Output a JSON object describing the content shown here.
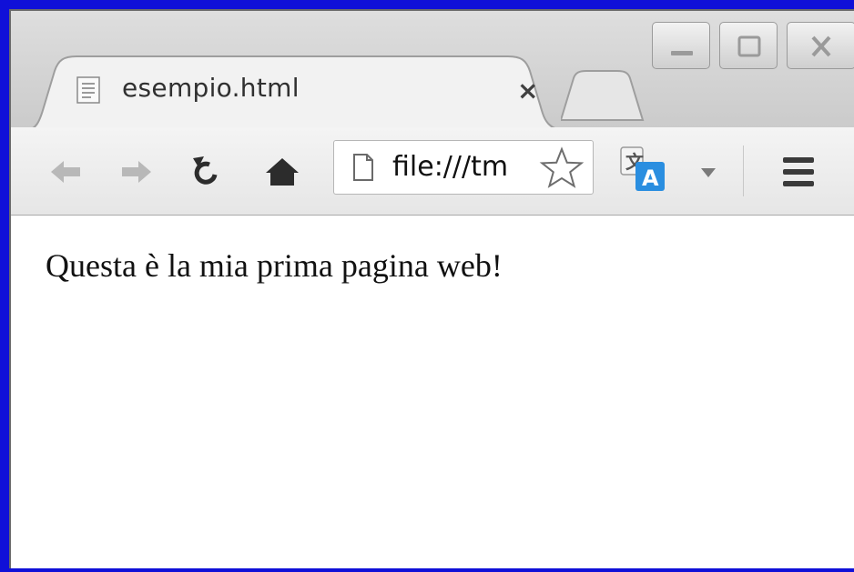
{
  "window": {
    "controls": {
      "minimize_icon": "minimize-icon",
      "maximize_icon": "maximize-icon",
      "close_icon": "close-icon"
    }
  },
  "tab": {
    "title": "esempio.html",
    "close_label": "×",
    "favicon": "document-icon"
  },
  "toolbar": {
    "back_icon": "back-arrow-icon",
    "forward_icon": "forward-arrow-icon",
    "reload_icon": "reload-icon",
    "home_icon": "home-icon",
    "address": {
      "value": "file:///tm",
      "page_icon": "page-icon",
      "bookmark_icon": "star-icon"
    },
    "translate_icon": "translate-icon",
    "dropdown_icon": "dropdown-arrow-icon",
    "menu_icon": "hamburger-menu-icon"
  },
  "page": {
    "body_text": "Questa è la mia prima pagina web!"
  },
  "colors": {
    "frame_border": "#1010d8",
    "chrome_bg": "#d9d9d9",
    "toolbar_bg": "#efefef",
    "translate_blue": "#2a8ee0"
  }
}
